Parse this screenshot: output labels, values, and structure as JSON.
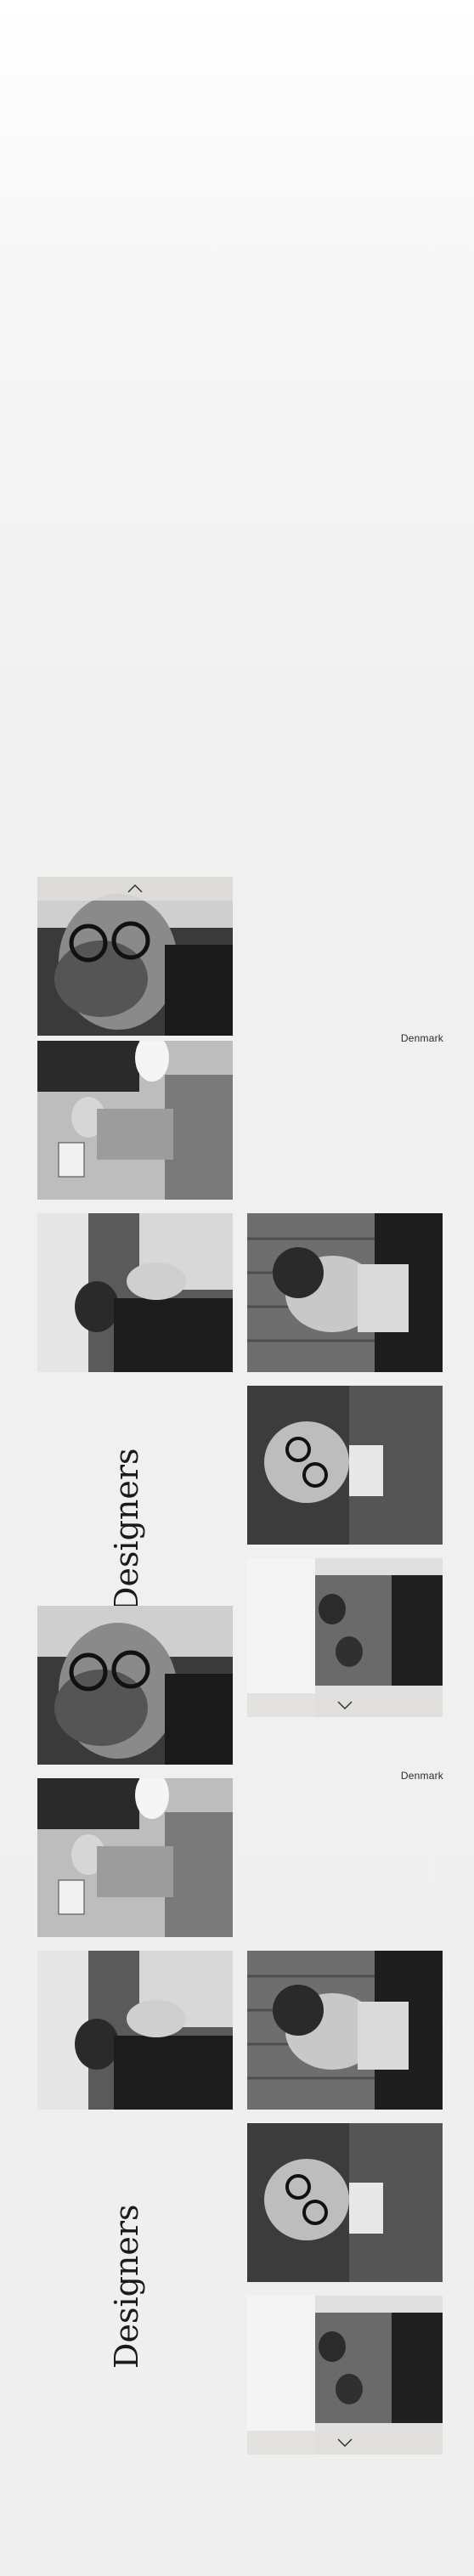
{
  "sections": [
    {
      "title": "Designers",
      "country": "Denmark"
    },
    {
      "title": "Designers",
      "country": "Denmark"
    }
  ],
  "photos": {
    "bearded_glasses": "Portrait of bearded man with round glasses",
    "seated_table": "Designer seated at table with lamp",
    "hand_to_face": "Man resting hand on face",
    "profile_wood": "Profile of man against wooden wall",
    "glasses_suit": "Man in glasses and patterned suit",
    "workshop_group": "Group working at a long bench"
  },
  "icons": {
    "scroll_up": "chevron-up-icon",
    "scroll_down": "chevron-down-icon"
  },
  "colors": {
    "background": "#efefef",
    "bar": "#e1deda",
    "text": "#1a1a1a"
  }
}
